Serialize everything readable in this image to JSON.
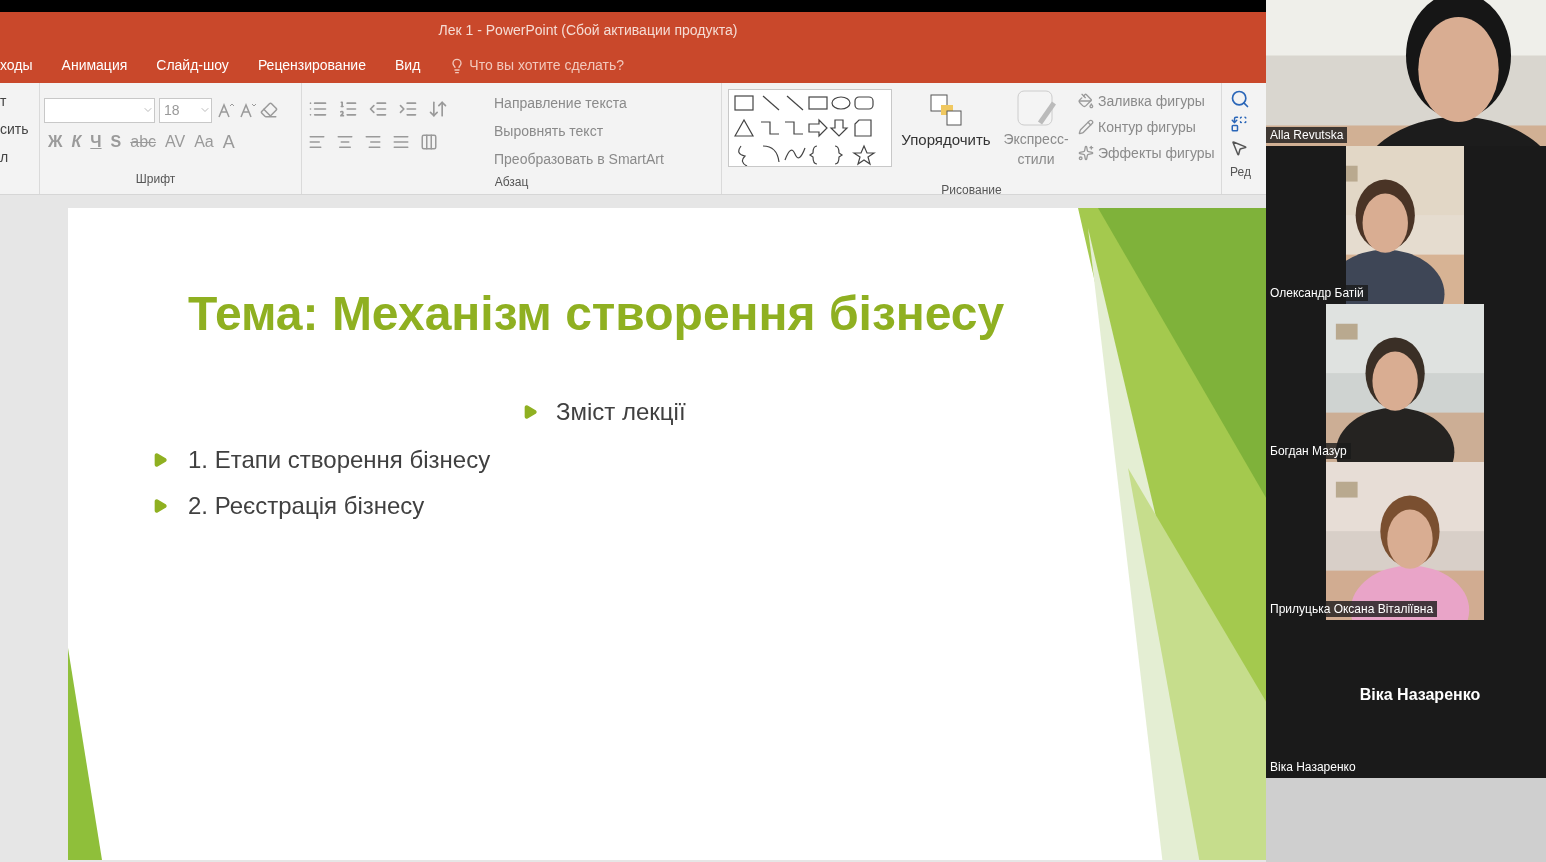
{
  "window": {
    "title": "Лек 1 - PowerPoint (Сбой активации продукта)"
  },
  "menu": [
    {
      "label": "ходы",
      "selected": false
    },
    {
      "label": "Анимация",
      "selected": false
    },
    {
      "label": "Слайд-шоу",
      "selected": false
    },
    {
      "label": "Рецензирование",
      "selected": false
    },
    {
      "label": "Вид",
      "selected": false
    }
  ],
  "tell_me": {
    "placeholder": "Что вы хотите сделать?"
  },
  "ribbon": {
    "clipboard": [
      "т",
      "сить",
      "л"
    ],
    "font": {
      "size": "18",
      "format_buttons": [
        "Ж",
        "К",
        "Ч",
        "S",
        "abc",
        "AV",
        "Aa",
        "A"
      ],
      "label": "Шрифт"
    },
    "paragraph": {
      "commands": [
        "Направление текста",
        "Выровнять текст",
        "Преобразовать в SmartArt"
      ],
      "label": "Абзац"
    },
    "drawing": {
      "arrange": "Упорядочить",
      "styles": "Экспресс-стили",
      "commands": [
        "Заливка фигуры",
        "Контур фигуры",
        "Эффекты фигуры"
      ],
      "label": "Рисование"
    },
    "editing": {
      "label": "Ред"
    }
  },
  "slide": {
    "title": "Тема: Механізм створення бізнесу",
    "subtitle": "Зміст лекції",
    "bullets": [
      "1. Етапи створення бізнесу",
      "2. Реєстрація бізнесу"
    ]
  },
  "participants": [
    {
      "name": "Alla Revutska",
      "kind": "video"
    },
    {
      "name": "Олександр Батій",
      "kind": "video"
    },
    {
      "name": "Богдан Мазур",
      "kind": "video"
    },
    {
      "name": "Прилуцька Оксана Віталіївна",
      "kind": "video"
    },
    {
      "name": "Віка Назаренко",
      "kind": "avatar",
      "display_name": "Віка Назаренко"
    }
  ]
}
